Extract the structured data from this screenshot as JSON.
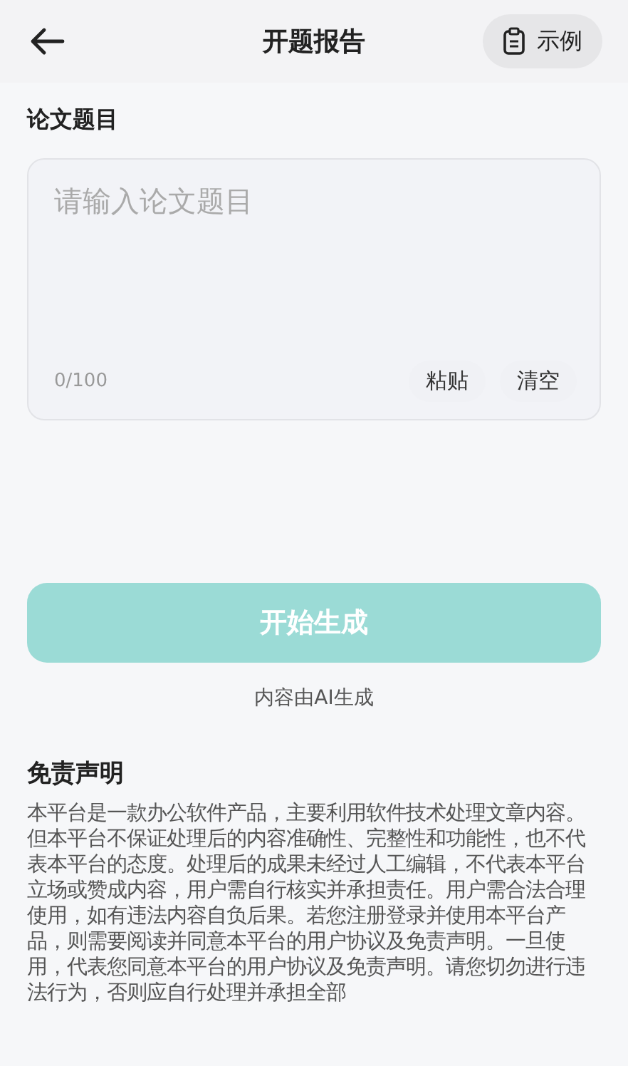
{
  "header": {
    "title": "开题报告",
    "example_button": "示例"
  },
  "topic": {
    "label": "论文题目",
    "placeholder": "请输入论文题目",
    "counter": "0/100",
    "actions": [
      "粘贴",
      "清空"
    ]
  },
  "generate": {
    "button": "开始生成",
    "disabled": true,
    "note": "内容由AI生成"
  },
  "disclaimer": {
    "title": "免责声明",
    "text": "本平台是一款办公软件产品，主要利用软件技术处理文章内容。但本平台不保证处理后的内容准确性、完整性和功能性，也不代表本平台的态度。处理后的成果未经过人工编辑，不代表本平台立场或赞成内容，用户需自行核实并承担责任。用户需合法合理使用，如有违法内容自负后果。若您注册登录并使用本平台产品，则需要阅读并同意本平台的用户协议及免责声明。一旦使用，代表您同意本平台的用户协议及免责声明。请您切勿进行违法行为，否则应自行处理并承担全部"
  }
}
